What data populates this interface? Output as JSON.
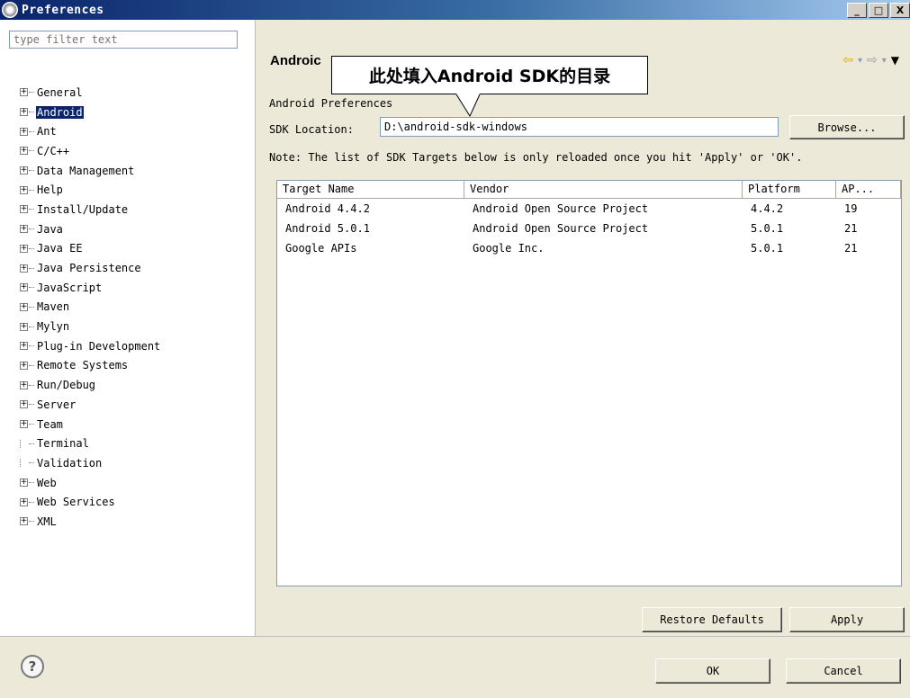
{
  "window": {
    "title": "Preferences",
    "controls": [
      "_",
      "□",
      "X"
    ]
  },
  "sidebar": {
    "filter_placeholder": "type filter text",
    "items": [
      {
        "label": "General",
        "expandable": true,
        "selected": false
      },
      {
        "label": "Android",
        "expandable": true,
        "selected": true
      },
      {
        "label": "Ant",
        "expandable": true,
        "selected": false
      },
      {
        "label": "C/C++",
        "expandable": true,
        "selected": false
      },
      {
        "label": "Data Management",
        "expandable": true,
        "selected": false
      },
      {
        "label": "Help",
        "expandable": true,
        "selected": false
      },
      {
        "label": "Install/Update",
        "expandable": true,
        "selected": false
      },
      {
        "label": "Java",
        "expandable": true,
        "selected": false
      },
      {
        "label": "Java EE",
        "expandable": true,
        "selected": false
      },
      {
        "label": "Java Persistence",
        "expandable": true,
        "selected": false
      },
      {
        "label": "JavaScript",
        "expandable": true,
        "selected": false
      },
      {
        "label": "Maven",
        "expandable": true,
        "selected": false
      },
      {
        "label": "Mylyn",
        "expandable": true,
        "selected": false
      },
      {
        "label": "Plug-in Development",
        "expandable": true,
        "selected": false
      },
      {
        "label": "Remote Systems",
        "expandable": true,
        "selected": false
      },
      {
        "label": "Run/Debug",
        "expandable": true,
        "selected": false
      },
      {
        "label": "Server",
        "expandable": true,
        "selected": false
      },
      {
        "label": "Team",
        "expandable": true,
        "selected": false
      },
      {
        "label": "Terminal",
        "expandable": false,
        "selected": false
      },
      {
        "label": "Validation",
        "expandable": false,
        "selected": false
      },
      {
        "label": "Web",
        "expandable": true,
        "selected": false
      },
      {
        "label": "Web Services",
        "expandable": true,
        "selected": false
      },
      {
        "label": "XML",
        "expandable": true,
        "selected": false
      }
    ]
  },
  "page": {
    "title": "Androic",
    "callout": "此处填入Android SDK的目录",
    "section_label": "Android Preferences",
    "sdk_label": "SDK Location:",
    "sdk_value": "D:\\android-sdk-windows",
    "browse_label": "Browse...",
    "note": "Note: The list of SDK Targets below is only reloaded once you hit 'Apply' or 'OK'.",
    "table": {
      "headers": [
        "Target Name",
        "Vendor",
        "Platform",
        "AP..."
      ],
      "rows": [
        [
          "Android 4.4.2",
          "Android Open Source Project",
          "4.4.2",
          "19"
        ],
        [
          "Android 5.0.1",
          "Android Open Source Project",
          "5.0.1",
          "21"
        ],
        [
          "Google APIs",
          "Google Inc.",
          "5.0.1",
          "21"
        ]
      ]
    },
    "restore_label": "Restore Defaults",
    "apply_label": "Apply"
  },
  "footer": {
    "help_glyph": "?",
    "ok_label": "OK",
    "cancel_label": "Cancel"
  },
  "icons": {
    "back": "arrow-left-icon",
    "forward": "arrow-right-icon",
    "menu": "dropdown-triangle-icon",
    "help": "question-mark-icon"
  }
}
